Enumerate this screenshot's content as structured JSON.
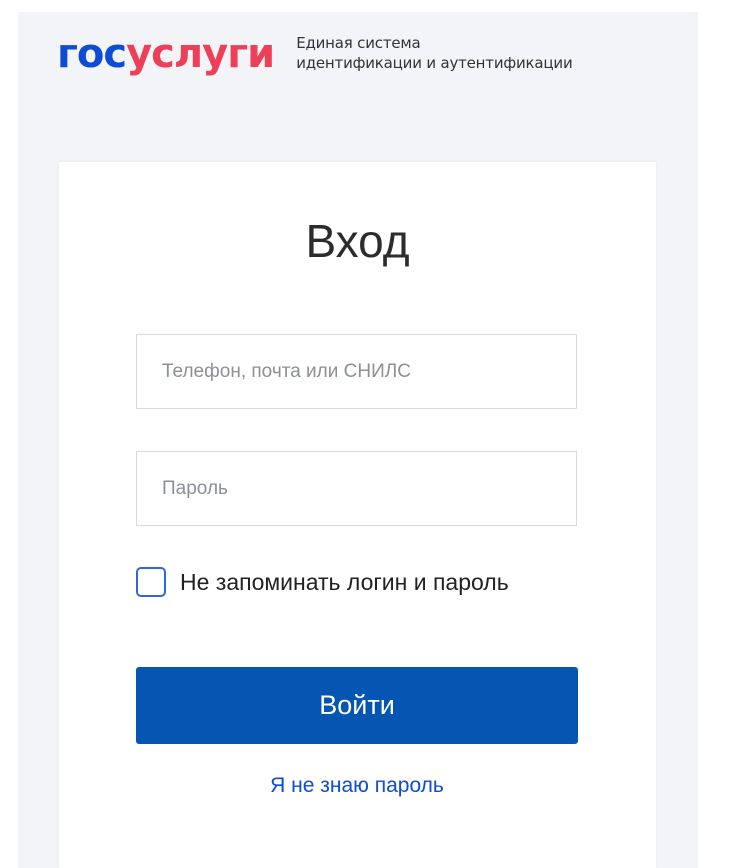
{
  "header": {
    "logo": {
      "part1": "гос",
      "part2": "услуги"
    },
    "tagline_line1": "Единая система",
    "tagline_line2": "идентификации и аутентификации"
  },
  "login_form": {
    "title": "Вход",
    "login_field": {
      "value": "",
      "placeholder": "Телефон, почта или СНИЛС"
    },
    "password_field": {
      "value": "",
      "placeholder": "Пароль"
    },
    "remember_checkbox": {
      "label": "Не запоминать логин и пароль",
      "checked": false
    },
    "submit_label": "Войти",
    "forgot_password_label": "Я не знаю пароль"
  },
  "colors": {
    "brand_blue": "#0d4cd3",
    "brand_red": "#ee3f58",
    "button_blue": "#0555b2",
    "page_background": "#f2f4f7"
  }
}
